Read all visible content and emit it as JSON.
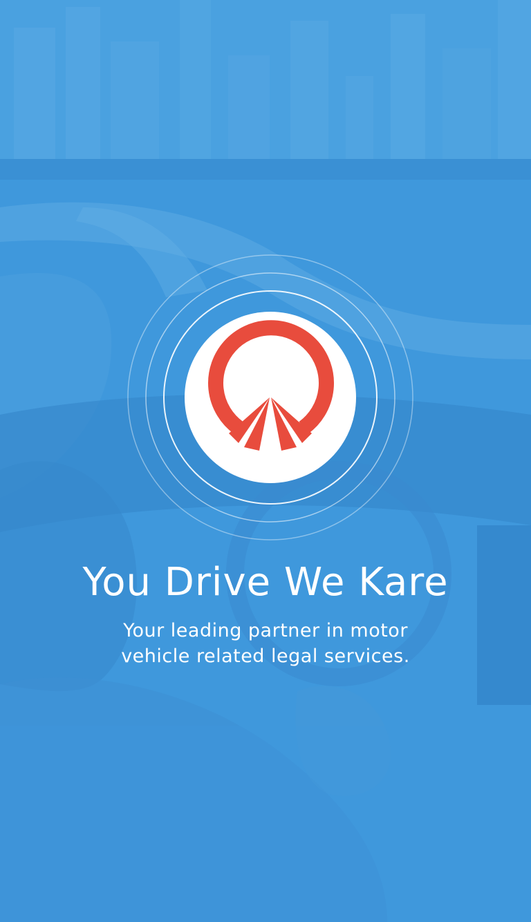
{
  "splash": {
    "headline": "You Drive We Kare",
    "tagline_line1": "Your leading partner in motor",
    "tagline_line2": "vehicle related legal services."
  },
  "background": {
    "tint_color": "#3f98dc",
    "scene": "city-highway-car-interior-photo"
  },
  "logo": {
    "icon": "steering-road-logo-icon",
    "mark_color": "#e84c3d",
    "disc_color": "#ffffff"
  },
  "rings": {
    "count": 3,
    "color": "#ffffff"
  }
}
